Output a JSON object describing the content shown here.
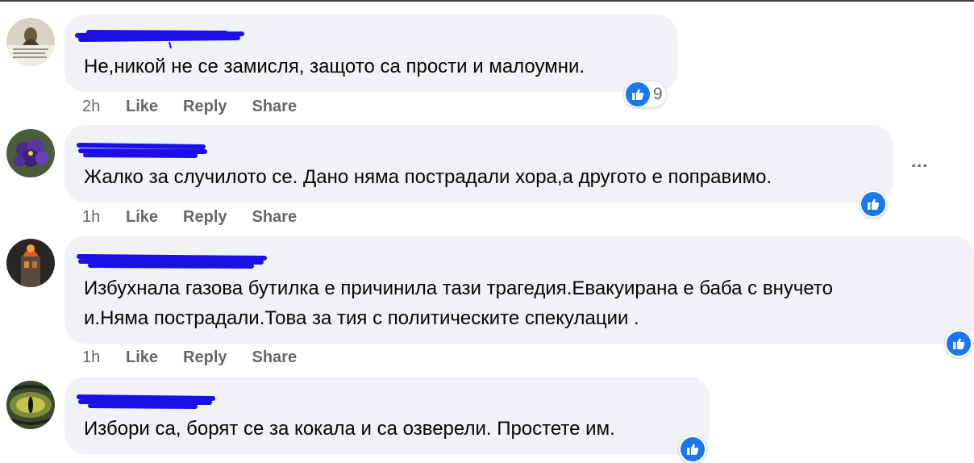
{
  "comments": [
    {
      "text": "Не,никой не се замисля, защото са прости и малоумни.",
      "time": "2h",
      "reaction_count": "9",
      "actions": {
        "like": "Like",
        "reply": "Reply",
        "share": "Share"
      }
    },
    {
      "text": "Жалко за случилото се. Дано няма пострадали хора,а другото е поправимо.",
      "time": "1h",
      "more_label": "...",
      "actions": {
        "like": "Like",
        "reply": "Reply",
        "share": "Share"
      }
    },
    {
      "text_line1": "Избухнала газова бутилка е причинила тази трагедия.Евакуирана е баба с внучето",
      "text_line2": "и.Няма пострадали.Това за тия с политическите спекулации .",
      "time": "1h",
      "actions": {
        "like": "Like",
        "reply": "Reply",
        "share": "Share"
      }
    },
    {
      "text": "Избори са, борят се за кокала и са озверели. Простете им."
    }
  ],
  "colors": {
    "bubble": "#f0f2f5",
    "like_blue": "#1877f2",
    "redaction": "#1a10e6",
    "meta_gray": "#65676b"
  },
  "icons": [
    "like-reaction-icon",
    "more-options-icon"
  ]
}
